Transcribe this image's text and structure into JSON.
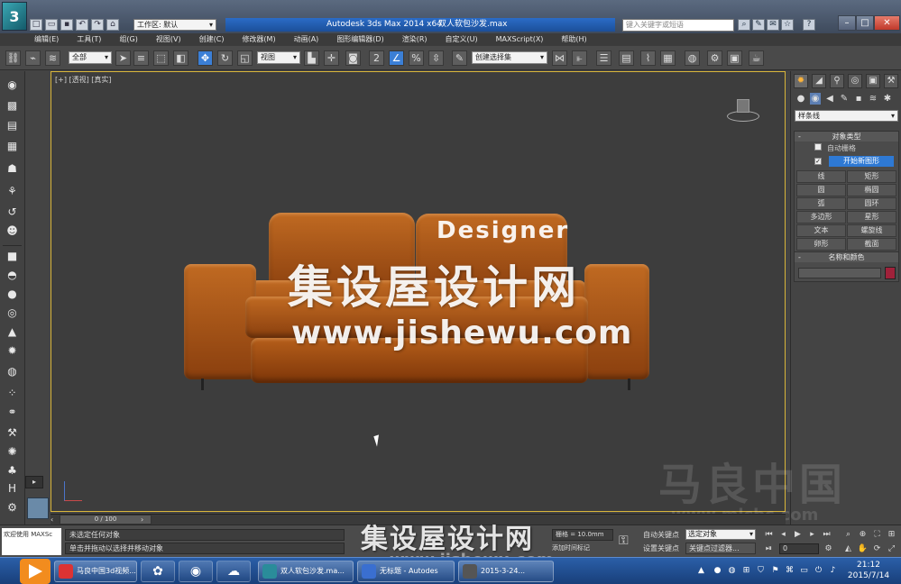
{
  "titlebar": {
    "workspace": "工作区: 默认",
    "app_name": "Autodesk 3ds Max  2014 x64",
    "file_name": "双人软包沙发.max",
    "search_placeholder": "键入关键字或短语"
  },
  "menu": [
    "编辑(E)",
    "工具(T)",
    "组(G)",
    "视图(V)",
    "创建(C)",
    "修改器(M)",
    "动画(A)",
    "图形编辑器(D)",
    "渲染(R)",
    "自定义(U)",
    "MAXScript(X)",
    "帮助(H)"
  ],
  "toolbar": {
    "selection_filter": "全部",
    "ref_coord": "视图",
    "named_selection": "创建选择集"
  },
  "viewport": {
    "label": "[+] [透视] [真实]"
  },
  "watermark": {
    "designer": "Designer",
    "site_cn": "集设屋设计网",
    "site_url": "www.jishewu.com",
    "corner_cn": "马良中国",
    "corner_url": "www.mlcbc.com",
    "bottom_cn": "集设屋设计网",
    "bottom_url": "www.jishewu.com"
  },
  "command_panel": {
    "category": "样条线",
    "object_type_title": "对象类型",
    "autogrid_label": "自动栅格",
    "start_new_shape": "开始新图形",
    "start_new_checked": "✓",
    "shape_buttons": [
      "线",
      "矩形",
      "圆",
      "椭圆",
      "弧",
      "圆环",
      "多边形",
      "星形",
      "文本",
      "螺旋线",
      "卵形",
      "截面"
    ],
    "name_color_title": "名称和颜色",
    "color": "#a0213a"
  },
  "timeline": {
    "frame_range": "0 / 100"
  },
  "status": {
    "maxscript": "欢迎使用 MAXSc",
    "line1": "未选定任何对象",
    "line2": "单击并拖动以选择并移动对象",
    "grid": "栅格 = 10.0mm",
    "add_time_tag": "添加时间标记",
    "auto_key": "自动关键点",
    "set_key": "设置关键点",
    "selection_set": "选定对象",
    "key_filters": "关键点过滤器...",
    "frame_value": "0"
  },
  "taskbar": {
    "tasks": [
      "马良中国3d视频...",
      "",
      "",
      "",
      "双人软包沙发.ma...",
      "无标题 - Autodes",
      "2015-3-24..."
    ],
    "clock_time": "21:12",
    "clock_date": "2015/7/14"
  }
}
